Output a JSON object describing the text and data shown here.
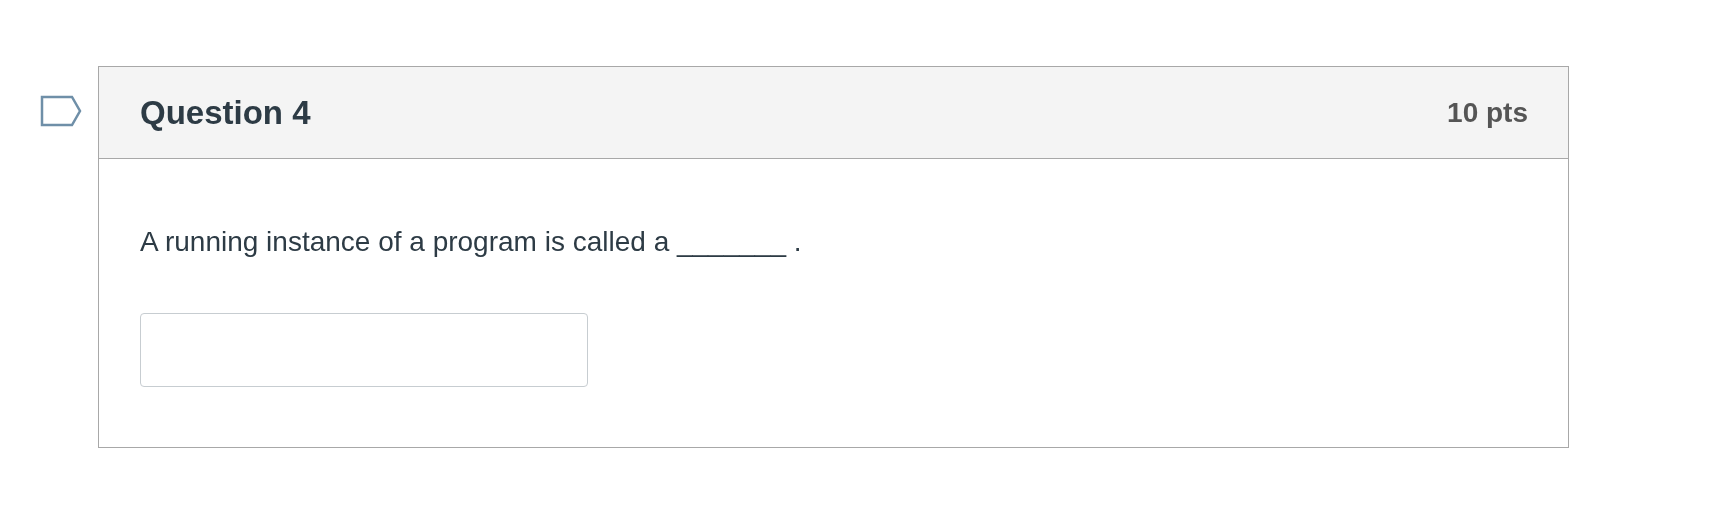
{
  "question": {
    "title": "Question 4",
    "points": "10 pts",
    "flagged": false,
    "text": "A running instance of a program is called a _______ ."
  }
}
